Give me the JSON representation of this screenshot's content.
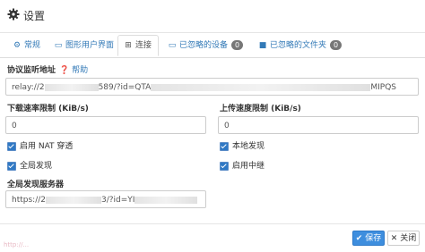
{
  "dialog": {
    "title": "设置"
  },
  "tabs": [
    {
      "label": "常规",
      "icon": "gear-icon"
    },
    {
      "label": "图形用户界面",
      "icon": "desktop-icon"
    },
    {
      "label": "连接",
      "icon": "sitemap-icon"
    },
    {
      "label": "已忽略的设备",
      "icon": "laptop-icon",
      "badge": "0"
    },
    {
      "label": "已忽略的文件夹",
      "icon": "folder-icon",
      "badge": "0"
    }
  ],
  "protocol": {
    "label": "协议监听地址",
    "help": "帮助",
    "value_start": "relay://2",
    "value_mid": "589/?id=QTA",
    "value_end": "MIPQS"
  },
  "download": {
    "label": "下载速率限制 (KiB/s)",
    "value": "0"
  },
  "upload": {
    "label": "上传速度限制 (KiB/s)",
    "value": "0"
  },
  "options": {
    "nat": "启用 NAT 穿透",
    "local": "本地发现",
    "global": "全局发现",
    "relay": "启用中继"
  },
  "global_servers": {
    "label": "全局发现服务器",
    "value_start": "https://2",
    "value_mid": "3/?id=YI"
  },
  "buttons": {
    "save": "保存",
    "close": "关闭"
  },
  "watermark": "http://..."
}
